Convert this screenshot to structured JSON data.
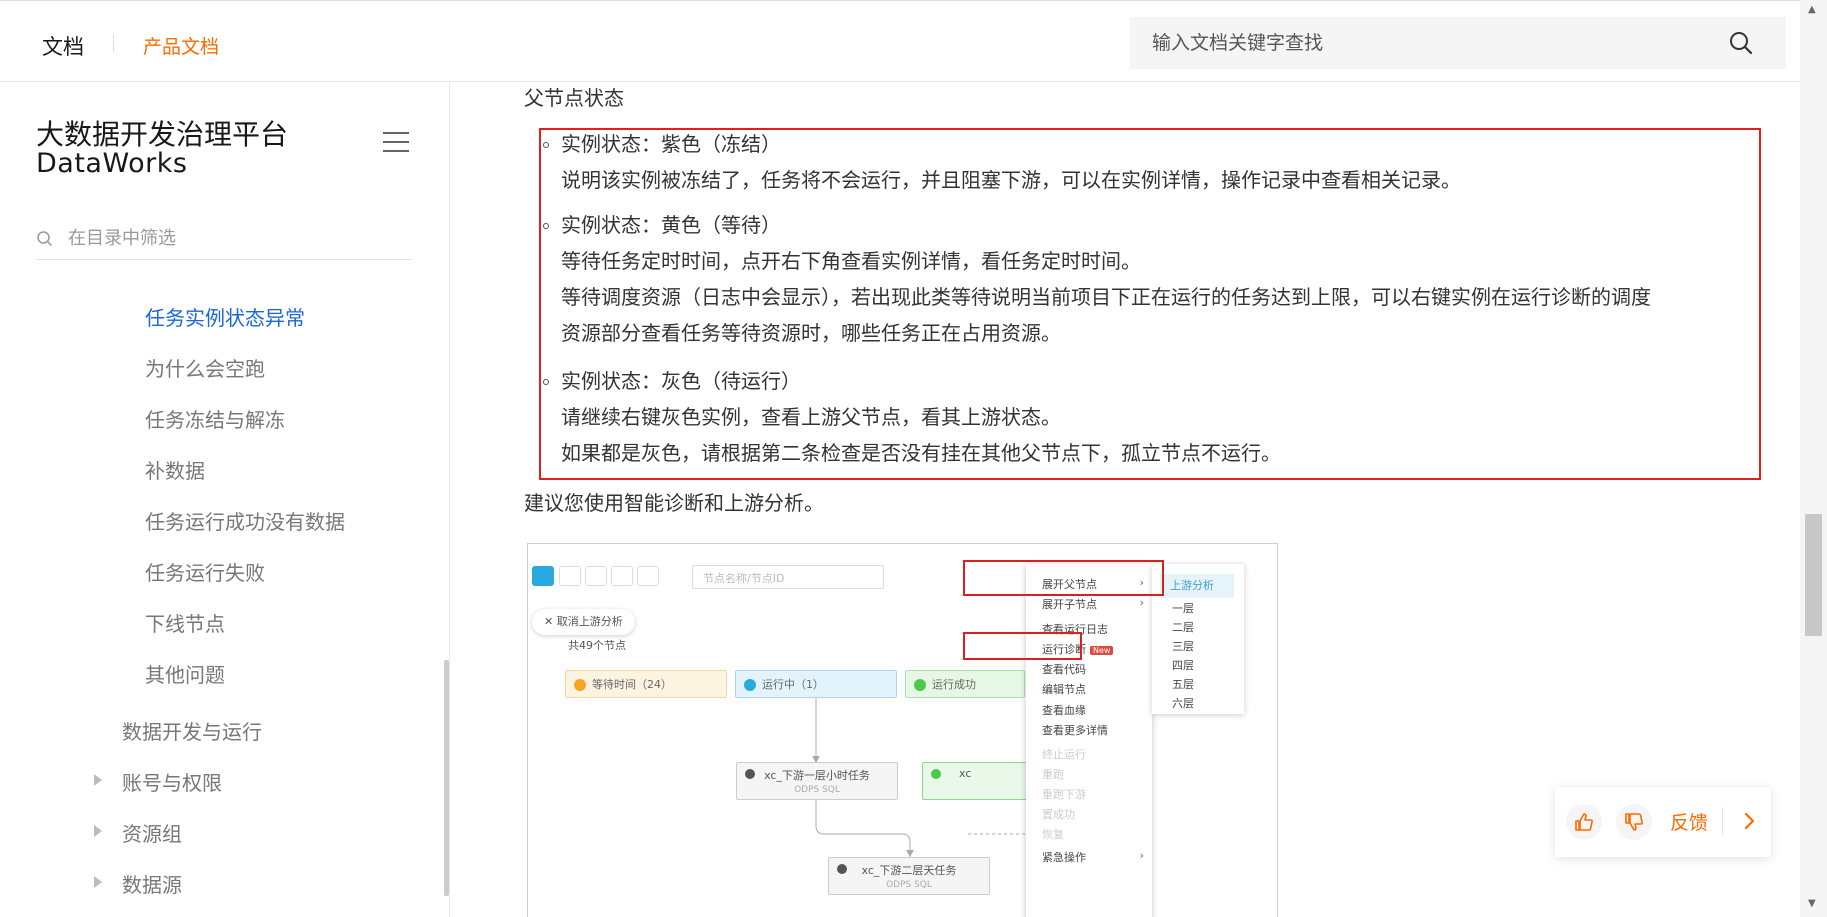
{
  "header": {
    "docs_label": "文档",
    "product_docs_label": "产品文档",
    "search_placeholder": "输入文档关键字查找"
  },
  "sidebar": {
    "title_cn": "大数据开发治理平台",
    "title_en": "DataWorks",
    "filter_placeholder": "在目录中筛选",
    "items": [
      {
        "label": "任务实例状态异常",
        "active": true
      },
      {
        "label": "为什么会空跑"
      },
      {
        "label": "任务冻结与解冻"
      },
      {
        "label": "补数据"
      },
      {
        "label": "任务运行成功没有数据"
      },
      {
        "label": "任务运行失败"
      },
      {
        "label": "下线节点"
      },
      {
        "label": "其他问题"
      }
    ],
    "sections": [
      {
        "label": "数据开发与运行"
      },
      {
        "label": "账号与权限"
      },
      {
        "label": "资源组"
      },
      {
        "label": "数据源"
      }
    ]
  },
  "content": {
    "heading": "父节点状态",
    "states": [
      {
        "title": "实例状态：紫色（冻结）",
        "lines": [
          "说明该实例被冻结了，任务将不会运行，并且阻塞下游，可以在实例详情，操作记录中查看相关记录。"
        ]
      },
      {
        "title": "实例状态：黄色（等待）",
        "lines": [
          "等待任务定时时间，点开右下角查看实例详情，看任务定时时间。",
          "等待调度资源（日志中会显示），若出现此类等待说明当前项目下正在运行的任务达到上限，可以右键实例在运行诊断的调度",
          "资源部分查看任务等待资源时，哪些任务正在占用资源。"
        ]
      },
      {
        "title": "实例状态：灰色（待运行）",
        "lines": [
          "请继续右键灰色实例，查看上游父节点，看其上游状态。",
          "如果都是灰色，请根据第二条检查是否没有挂在其他父节点下，孤立节点不运行。"
        ]
      }
    ],
    "suggestion": "建议您使用智能诊断和上游分析。"
  },
  "screenshot": {
    "search_placeholder": "节点名称/节点ID",
    "cancel_label": "取消上游分析",
    "total_nodes": "共49个节点",
    "chips": [
      {
        "label": "等待时间（24）",
        "color": "#f5a623"
      },
      {
        "label": "运行中（1）",
        "color": "#29a9e0"
      },
      {
        "label": "运行成功",
        "color": "#4cc84c"
      }
    ],
    "node1": {
      "name": "xc_下游一层小时任务",
      "type": "ODPS SQL"
    },
    "node2": {
      "name": "xc",
      "type": ""
    },
    "node3": {
      "name": "xc_下游二层天任务",
      "type": "ODPS SQL"
    },
    "menu": [
      "展开父节点",
      "展开子节点",
      "查看运行日志",
      "运行诊断",
      "查看代码",
      "编辑节点",
      "查看血缘",
      "查看更多详情",
      "终止运行",
      "重跑",
      "重跑下游",
      "置成功",
      "恢复",
      "紧急操作"
    ],
    "new_tag": "New",
    "submenu": [
      "上游分析",
      "一层",
      "二层",
      "三层",
      "四层",
      "五层",
      "六层"
    ]
  },
  "feedback": {
    "label": "反馈"
  },
  "colors": {
    "accent": "#ff6a00",
    "link": "#1b67d6",
    "highlight_border": "#e02020"
  }
}
